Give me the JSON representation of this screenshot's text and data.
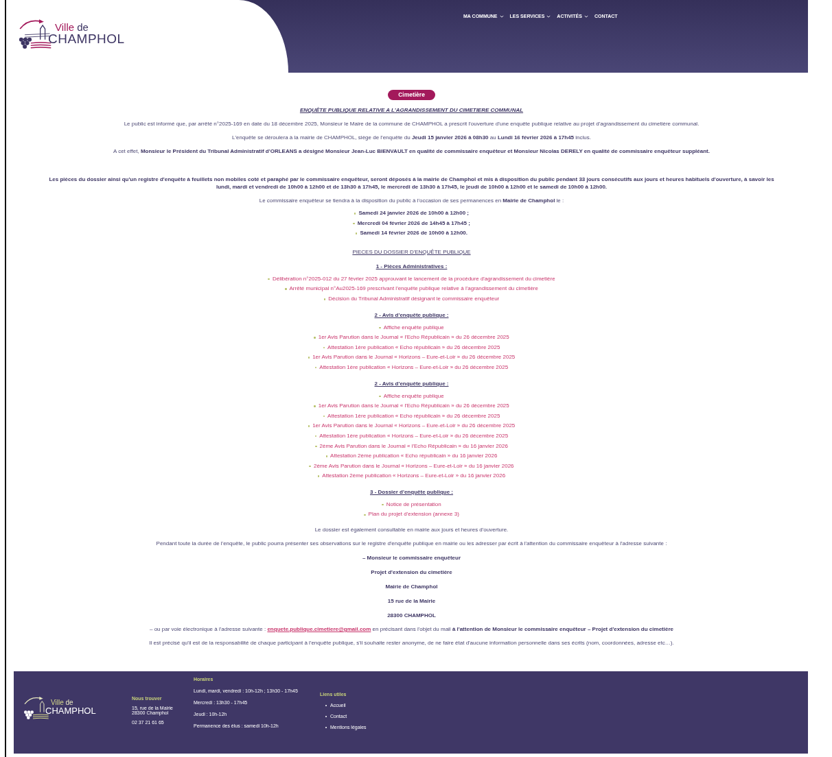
{
  "header": {
    "logo": {
      "ville": "Ville",
      "de": "de",
      "name": "CHAMPHOL"
    },
    "nav": [
      {
        "label": "MA COMMUNE",
        "dropdown": true
      },
      {
        "label": "LES SERVICES",
        "dropdown": true
      },
      {
        "label": "ACTIVITÉS",
        "dropdown": true
      },
      {
        "label": "CONTACT",
        "dropdown": false
      }
    ]
  },
  "article": {
    "category": "Cimetière",
    "title": "ENQUÊTE PUBLIQUE RELATIVE A L'AGRANDISSEMENT DU CIMETIERE COMMUNAL",
    "blocks": [
      {
        "kind": "text",
        "text": "Le public est informé que, par arrêté n°2025-169 en date du 18 décembre 2025, Monsieur le Maire de la commune de CHAMPHOL a prescrit l'ouverture d'une enquête publique relative au projet d'agrandissement du cimetière communal."
      },
      {
        "kind": "text",
        "text": "L'enquête se déroulera à la mairie de CHAMPHOL, siège de l'enquête du **Jeudi 15 janvier 2026 à 08h30** au **Lundi 16 février 2026 à 17h45** inclus."
      },
      {
        "kind": "text",
        "text": "A cet effet, **Monsieur le Président du Tribunal Administratif d'ORLEANS a désigné Monsieur Jean-Luc BIENVAULT en qualité de commissaire enquêteur et Monsieur Nicolas DERELY en qualité de commissaire enquêteur suppléant.**"
      },
      {
        "kind": "strong_text",
        "text": "Les pièces du dossier ainsi qu'un registre d'enquête à feuillets non mobiles coté et paraphé par le commissaire enquêteur, seront déposés à la mairie de Champhol et mis à disposition du public pendant 33 jours consécutifs aux jours et heures habituels d'ouverture, à savoir les lundi, mardi et vendredi de 10h00 à 12h00 et de 13h30 à 17h45, le mercredi de 13h30 à 17h45, le jeudi de 10h00 à 12h00 et le samedi de 10h00 à 12h00."
      },
      {
        "kind": "text",
        "text": "Le commissaire enquêteur se tiendra à la disposition du public à l'occasion de ses permanences en **Mairie de Champhol** le :"
      },
      {
        "kind": "schedule",
        "items": [
          "Samedi 24 janvier 2026 de 10h00 à 12h00 ;",
          "Mercredi 04 février 2026 de 14h45 à 17h45 ;",
          "Samedi 14 février 2026 de 10h00 à 12h00."
        ]
      },
      {
        "kind": "section_title",
        "text": "PIECES DU DOSSIER D'ENQUÊTE PUBLIQUE"
      },
      {
        "kind": "subheading",
        "text": "1 - Pièces Administratives :"
      },
      {
        "kind": "documents",
        "items": [
          "Délibération n°2025-012 du 27 février 2025 approuvant le lancement de la procédure d'agrandissement du cimetière",
          "Arrêté municipal n°Au2025-169 prescrivant l'enquête publique relative à l'agrandissement du cimetière",
          "Décision du Tribunal Administratif désignant le commissaire enquêteur"
        ]
      },
      {
        "kind": "subheading",
        "text": "2 - Avis d'enquête publique :"
      },
      {
        "kind": "documents",
        "items": [
          "Affiche enquête publique",
          "1er Avis Parution dans le Journal « l'Echo Républicain » du 26 décembre 2025",
          "Attestation 1ère publication « Echo républicain » du 26 décembre 2025",
          "1er Avis Parution dans le Journal « Horizons – Eure-et-Loir » du 26 décembre 2025",
          "Attestation 1ère publication « Horizons – Eure-et-Loir » du 26 décembre 2025"
        ]
      },
      {
        "kind": "subheading",
        "text": "2 - Avis d'enquête publique :"
      },
      {
        "kind": "documents",
        "items": [
          "Affiche enquête publique",
          "1er Avis Parution dans le Journal « l'Echo Républicain » du 26 décembre 2025",
          "Attestation 1ère publication « Echo républicain » du 26 décembre 2025",
          "1er Avis Parution dans le Journal « Horizons – Eure-et-Loir » du 26 décembre 2025",
          "Attestation 1ère publication « Horizons – Eure-et-Loir » du 26 décembre 2025",
          "2ème Avis Parution dans le Journal « l'Echo Républicain » du 16 janvier 2026",
          "Attestation 2ème publication « Echo républicain » du 16 janvier 2026",
          "2ème Avis Parution dans le Journal « Horizons – Eure-et-Loir » du 16  janvier 2026",
          "Attestation 2ème publication « Horizons – Eure-et-Loir » du 16 janvier 2026"
        ]
      },
      {
        "kind": "subheading",
        "text": "3 - Dossier d'enquête publique :"
      },
      {
        "kind": "documents",
        "items": [
          "Notice de présentation",
          "Plan du projet d'extension (annexe 3)"
        ]
      },
      {
        "kind": "text",
        "text": "Le dossier est également consultable en mairie aux jours et heures d'ouverture."
      },
      {
        "kind": "text",
        "text": "Pendant toute la durée de l'enquête, le public pourra présenter ses observations sur le registre d'enquête publique en mairie ou les adresser par écrit à l'attention du commissaire enquêteur à l'adresse suivante :"
      },
      {
        "kind": "address_line",
        "text": "– Monsieur le commissaire enquêteur"
      },
      {
        "kind": "address_line",
        "text": "Projet d'extension du cimetière"
      },
      {
        "kind": "address_line",
        "text": "Mairie de Champhol"
      },
      {
        "kind": "address_line",
        "text": "15 rue de la Mairie"
      },
      {
        "kind": "address_line",
        "text": "28300 CHAMPHOL"
      },
      {
        "kind": "mail_text",
        "before": "– ou par voie électronique à l'adresse suivante :",
        "link": "enquete.publique.cimetiere@gmail.com",
        "after": "en précisant dans l'objet du mail **à l'attention de Monsieur le commissaire enquêteur – Projet d'extension du cimetière**"
      },
      {
        "kind": "text",
        "text": "Il est précisé qu'il est de la responsabilité de chaque participant à l'enquête publique, s'il souhaite rester anonyme, de ne faire état d'aucune information personnelle dans ses écrits (nom, coordonnées, adresse etc…)."
      }
    ]
  },
  "footer": {
    "logo": {
      "ville": "Ville",
      "de": "de",
      "name": "CHAMPHOL"
    },
    "find_us": {
      "heading": "Nous trouver",
      "address": [
        "15, rue de la Mairie",
        "28300 Champhol"
      ],
      "phone": "02 37 21 61 65"
    },
    "hours": {
      "heading": "Horaires",
      "lines": [
        "Lundi, mardi, vendredi : 10h-12h ; 13h30 - 17h45",
        "Mercredi : 13h30 - 17h45",
        "Jeudi : 10h-12h",
        "Permanence des élus : samedi 10h-12h"
      ]
    },
    "links": {
      "heading": "Liens utiles",
      "items": [
        "Accueil",
        "Contact",
        "Mentions légales"
      ]
    }
  }
}
